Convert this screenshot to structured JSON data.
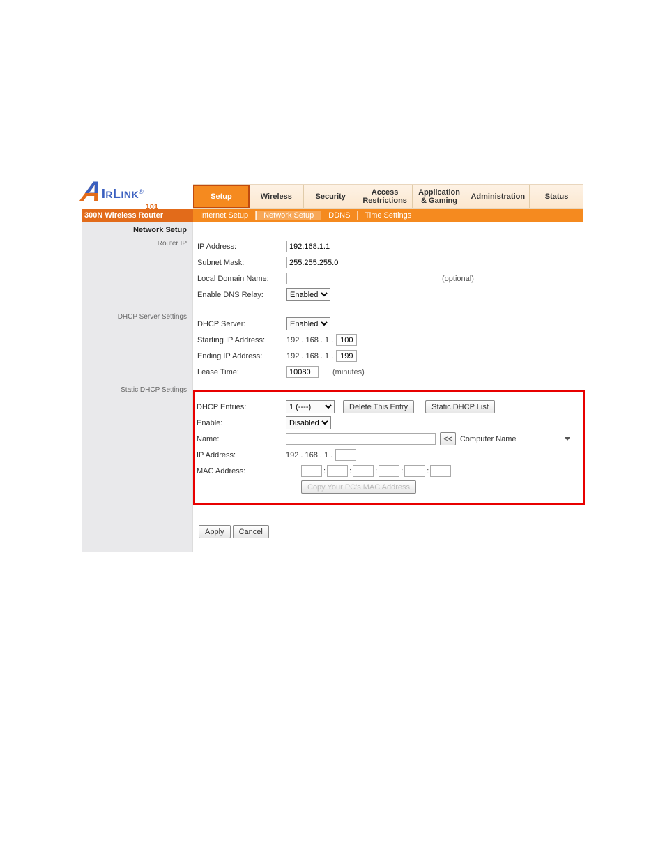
{
  "brand": {
    "name": "AIRLINK",
    "suffix": "101",
    "reg": "®"
  },
  "product": "300N Wireless Router",
  "tabs": [
    "Setup",
    "Wireless",
    "Security",
    "Access Restrictions",
    "Application & Gaming",
    "Administration",
    "Status"
  ],
  "subtabs": [
    "Internet Setup",
    "Network Setup",
    "DDNS",
    "Time Settings"
  ],
  "sidebar": {
    "title": "Network Setup",
    "rows": [
      "Router IP",
      "",
      "",
      "",
      "",
      "DHCP Server Settings",
      "",
      "",
      "",
      "",
      "Static DHCP Settings"
    ]
  },
  "router_ip": {
    "labels": {
      "ip": "IP Address:",
      "mask": "Subnet Mask:",
      "domain": "Local Domain Name:",
      "dns": "Enable DNS Relay:"
    },
    "ip": "192.168.1.1",
    "mask": "255.255.255.0",
    "domain": "",
    "optional": "(optional)",
    "dns_relay": "Enabled"
  },
  "dhcp": {
    "labels": {
      "server": "DHCP Server:",
      "start": "Starting IP Address:",
      "end": "Ending IP Address:",
      "lease": "Lease Time:"
    },
    "server": "Enabled",
    "ip_prefix": "192 . 168 .  1  .",
    "start_oct": "100",
    "end_oct": "199",
    "lease": "10080",
    "lease_unit": "(minutes)"
  },
  "static": {
    "labels": {
      "entries": "DHCP Entries:",
      "enable": "Enable:",
      "name": "Name:",
      "ip": "IP Address:",
      "mac": "MAC Address:"
    },
    "entries_value": "1 (----)",
    "delete_btn": "Delete This Entry",
    "list_btn": "Static DHCP List",
    "enable": "Disabled",
    "name": "",
    "arrow": "<<",
    "computer_name": "Computer Name",
    "ip_prefix": "192 . 168 .  1  .",
    "ip_oct": "",
    "mac": [
      "",
      "",
      "",
      "",
      "",
      ""
    ],
    "copy_btn": "Copy Your PC's MAC Address"
  },
  "actions": {
    "apply": "Apply",
    "cancel": "Cancel"
  }
}
